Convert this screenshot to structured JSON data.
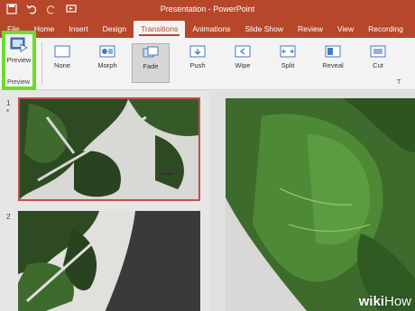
{
  "window": {
    "title": "Presentation - PowerPoint"
  },
  "tabs": [
    "File",
    "Home",
    "Insert",
    "Design",
    "Transitions",
    "Animations",
    "Slide Show",
    "Review",
    "View",
    "Recording"
  ],
  "active_tab": "Transitions",
  "ribbon": {
    "preview_label": "Preview",
    "preview_group_label": "Preview",
    "buttons": [
      "None",
      "Morph",
      "Fade",
      "Push",
      "Wipe",
      "Split",
      "Reveal",
      "Cut"
    ],
    "selected": "Fade"
  },
  "slides": [
    {
      "number": "1",
      "marker": "*"
    },
    {
      "number": "2"
    }
  ],
  "watermark": {
    "wiki": "wiki",
    "how": "How"
  },
  "colors": {
    "accent": "#b7472a",
    "highlight": "#6cdc2a",
    "selected_border": "#c0504d"
  }
}
